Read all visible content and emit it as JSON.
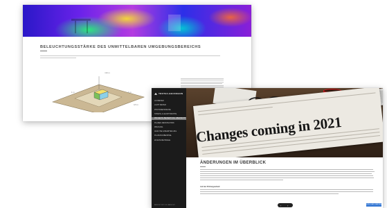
{
  "back_page": {
    "title": "BELEUCHTUNGSSTÄRKE DES UNMITTELBAREN UMGEBUNGSBEREICHS",
    "dims": {
      "top": "≈20 m",
      "left": "1 m",
      "right": "1 m",
      "bottom": "0,5 m"
    }
  },
  "front_page": {
    "logo": "TROTEC-BECKMANN",
    "nav": [
      "LUXMETER",
      "LIGHT METER",
      "PHOTOMETRISCHE",
      "STRAHL & LEUCHTDICHTE",
      "PROJEKTE BEWERTUNG ÜBERSICHT",
      "PLANEN MESSTECHNIK",
      "PRÜFUNG",
      "ANALYSE & BEURTEILUNG",
      "PLANUNGSBEISPIEL",
      "ZUSATZ-BEITRÄGE"
    ],
    "active_nav_index": 4,
    "sidebar_footer": "ANSICHT MIT VOLLANSICHT",
    "hero_headline": "Changes coming in 2021",
    "content_title": "ÄNDERUNGEN IM ÜBERBLICK",
    "subhead": "Auf der Prüfungsarbeit:",
    "chat_label": "LIVE-CHAT STARTEN",
    "pager": {
      "prev": "‹",
      "next": "›"
    }
  }
}
